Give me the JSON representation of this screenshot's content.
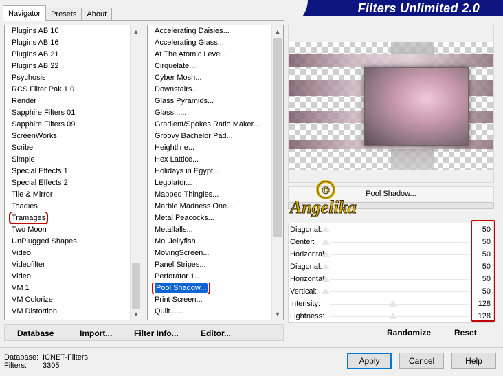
{
  "banner": {
    "title": "Filters Unlimited 2.0"
  },
  "tabs": [
    {
      "label": "Navigator",
      "active": true
    },
    {
      "label": "Presets",
      "active": false
    },
    {
      "label": "About",
      "active": false
    }
  ],
  "categories": [
    "Plugins AB 10",
    "Plugins AB 16",
    "Plugins AB 21",
    "Plugins AB 22",
    "Psychosis",
    "RCS Filter Pak 1.0",
    "Render",
    "Sapphire Filters 01",
    "Sapphire Filters 09",
    "ScreenWorks",
    "Scribe",
    "Simple",
    "Special Effects 1",
    "Special Effects 2",
    "Tile & Mirror",
    "Toadies",
    "Tramages",
    "Two Moon",
    "UnPlugged Shapes",
    "Video",
    "Videofilter",
    "Video",
    "VM 1",
    "VM Colorize",
    "VM Distortion"
  ],
  "filters": [
    "Accelerating Daisies...",
    "Accelerating Glass...",
    "At The Atomic Level...",
    "Cirquelate...",
    "Cyber Mosh...",
    "Downstairs...",
    "Glass Pyramids...",
    "Glass......",
    "Gradient/Spokes Ratio Maker...",
    "Groovy Bachelor Pad...",
    "Heightline...",
    "Hex Lattice...",
    "Holidays in Egypt...",
    "Legolator...",
    "Mapped Thingies...",
    "Marble Madness One...",
    "Metal Peacocks...",
    "Metalfalls...",
    "Mo' Jellyfish...",
    "MovingScreen...",
    "Panel Stripes...",
    "Perforator 1...",
    "Pool Shadow...",
    "Print Screen...",
    "Quilt......"
  ],
  "list_buttons": {
    "database": "Database",
    "import": "Import...",
    "filter_info": "Filter Info...",
    "editor": "Editor..."
  },
  "filter_name": "Pool Shadow...",
  "logo": {
    "text": "Angelika",
    "symbol": "©"
  },
  "params": [
    {
      "label": "Diagonal:",
      "value": "50"
    },
    {
      "label": "Center:",
      "value": "50"
    },
    {
      "label": "Horizontal:",
      "value": "50"
    },
    {
      "label": "Diagonal:",
      "value": "50"
    },
    {
      "label": "Horizontal:",
      "value": "50"
    },
    {
      "label": "Vertical:",
      "value": "50"
    },
    {
      "label": "Intensity:",
      "value": "128"
    },
    {
      "label": "Lightness:",
      "value": "128"
    }
  ],
  "param_buttons": {
    "randomize": "Randomize",
    "reset": "Reset"
  },
  "status": {
    "database_label": "Database:",
    "database_value": "ICNET-Filters",
    "filters_label": "Filters:",
    "filters_value": "3305"
  },
  "footer_buttons": {
    "apply": "Apply",
    "cancel": "Cancel",
    "help": "Help"
  },
  "colors": {
    "banner": "#0c1480",
    "selection": "#0a64d4",
    "highlight_box": "#c00000"
  }
}
